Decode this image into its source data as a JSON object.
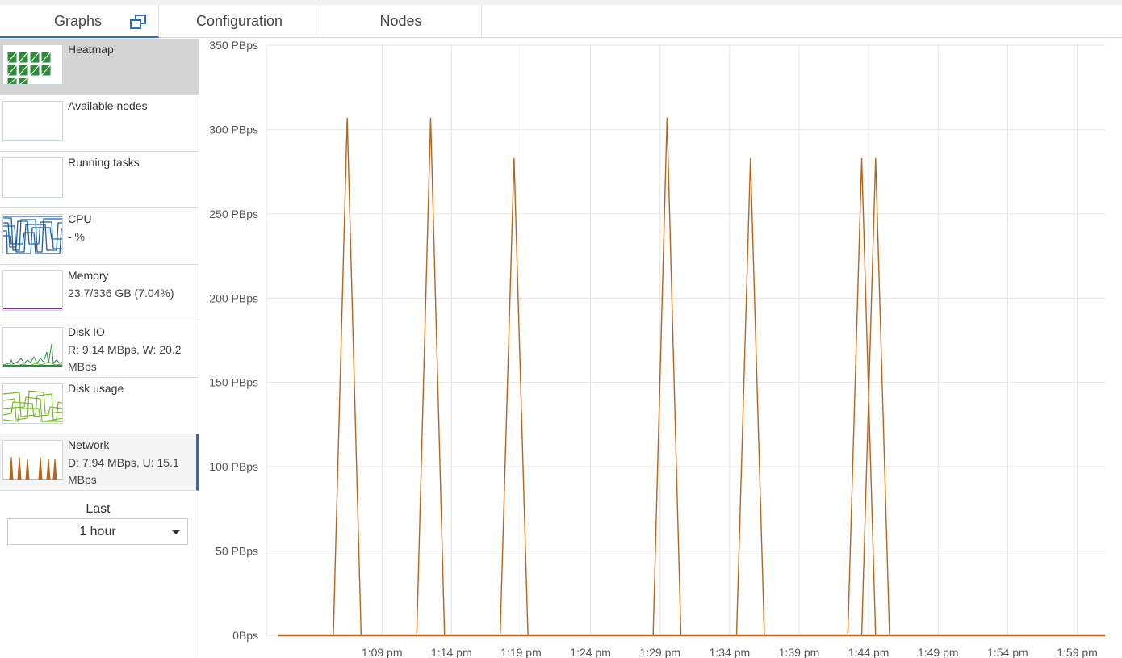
{
  "tabs": [
    {
      "label": "Graphs",
      "active": true
    },
    {
      "label": "Configuration",
      "active": false
    },
    {
      "label": "Nodes",
      "active": false
    }
  ],
  "sidebar": {
    "items": [
      {
        "title": "Heatmap",
        "subtitle": "",
        "thumb": "heatmap"
      },
      {
        "title": "Available nodes",
        "subtitle": "",
        "thumb": "empty"
      },
      {
        "title": "Running tasks",
        "subtitle": "",
        "thumb": "empty"
      },
      {
        "title": "CPU",
        "subtitle": "- %",
        "thumb": "cpu"
      },
      {
        "title": "Memory",
        "subtitle": "23.7/336 GB (7.04%)",
        "thumb": "memory"
      },
      {
        "title": "Disk IO",
        "subtitle": "R: 9.14 MBps, W: 20.2 MBps",
        "thumb": "diskio"
      },
      {
        "title": "Disk usage",
        "subtitle": "",
        "thumb": "diskusage"
      },
      {
        "title": "Network",
        "subtitle": "D: 7.94 MBps, U: 15.1 MBps",
        "thumb": "network"
      }
    ],
    "range_label": "Last",
    "range_value": "1 hour"
  },
  "colors": {
    "accent": "#2a6ebb",
    "series": "#b8651a",
    "heatmap": "#2e8b3a",
    "cpu": "#1f5fa8",
    "memory": "#7b2fa0",
    "disk": "#7cb82f"
  },
  "chart_data": {
    "type": "line",
    "y_ticks": [
      "350 PBps",
      "300 PBps",
      "250 PBps",
      "200 PBps",
      "150 PBps",
      "100 PBps",
      "50 PBps",
      "0Bps"
    ],
    "x_ticks": [
      "1:09 pm",
      "1:14 pm",
      "1:19 pm",
      "1:24 pm",
      "1:29 pm",
      "1:34 pm",
      "1:39 pm",
      "1:44 pm",
      "1:49 pm",
      "1:54 pm",
      "1:59 pm"
    ],
    "ylim": [
      0,
      350
    ],
    "y_unit": "PBps",
    "x_range_minutes": [
      1.5,
      61
    ],
    "grid": true,
    "series": [
      {
        "color": "#b8651a",
        "points": [
          [
            1.5,
            0
          ],
          [
            5.5,
            0
          ],
          [
            6.5,
            307
          ],
          [
            7.5,
            0
          ],
          [
            11.5,
            0
          ],
          [
            12.5,
            307
          ],
          [
            13.5,
            0
          ],
          [
            17.5,
            0
          ],
          [
            18.5,
            283
          ],
          [
            19.5,
            0
          ],
          [
            28.5,
            0
          ],
          [
            29.5,
            307
          ],
          [
            30.5,
            0
          ],
          [
            34.5,
            0
          ],
          [
            35.5,
            283
          ],
          [
            36.5,
            0
          ],
          [
            42.5,
            0
          ],
          [
            43.5,
            283
          ],
          [
            44.5,
            0
          ],
          [
            43.5,
            0
          ],
          [
            44.5,
            283
          ],
          [
            45.5,
            0
          ],
          [
            61,
            0
          ]
        ]
      }
    ]
  }
}
